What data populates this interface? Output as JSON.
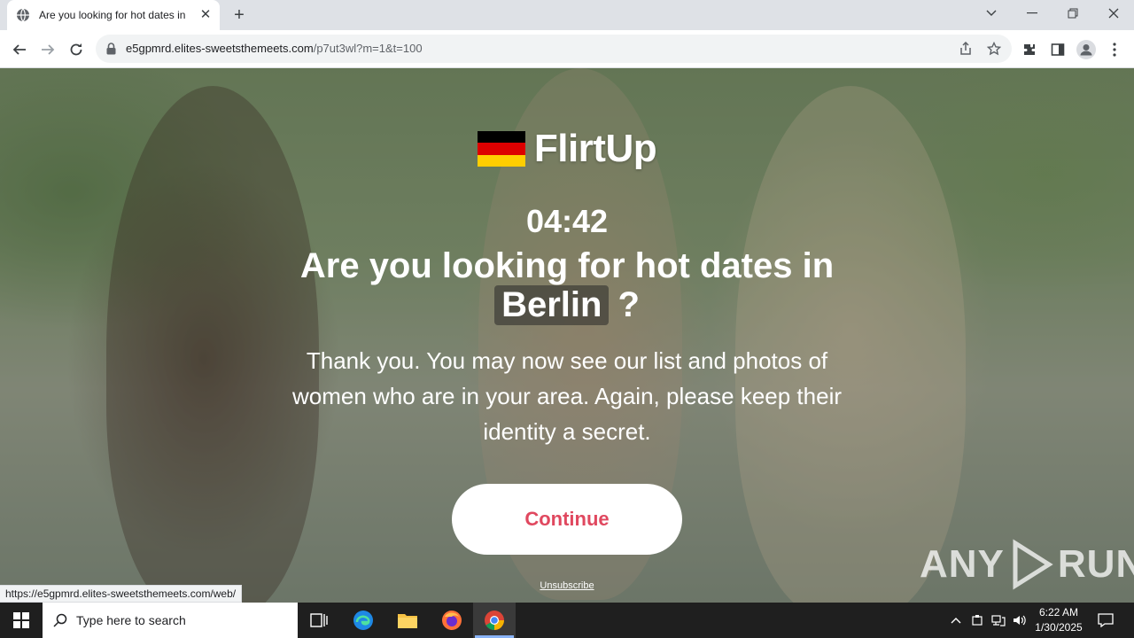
{
  "browser": {
    "tab_title": "Are you looking for hot dates in",
    "new_tab_symbol": "+",
    "url_host": "e5gpmrd.elites-sweetsthemeets.com",
    "url_path": "/p7ut3wl?m=1&t=100",
    "status_url": "https://e5gpmrd.elites-sweetsthemeets.com/web/"
  },
  "page": {
    "brand": "FlirtUp",
    "flag_colors": [
      "#000000",
      "#dd0000",
      "#ffce00"
    ],
    "timer": "04:42",
    "headline": "Are you looking for hot dates in",
    "city": "Berlin",
    "question_mark": "?",
    "message": "Thank you. You may now see our list and photos of women who are in your area. Again, please keep their identity a secret.",
    "continue_label": "Continue",
    "unsubscribe_label": "Unsubscribe",
    "accent_color": "#e0485f"
  },
  "watermark": {
    "left_text": "ANY",
    "right_text": "RUN"
  },
  "taskbar": {
    "search_placeholder": "Type here to search",
    "time": "6:22 AM",
    "date": "1/30/2025"
  }
}
